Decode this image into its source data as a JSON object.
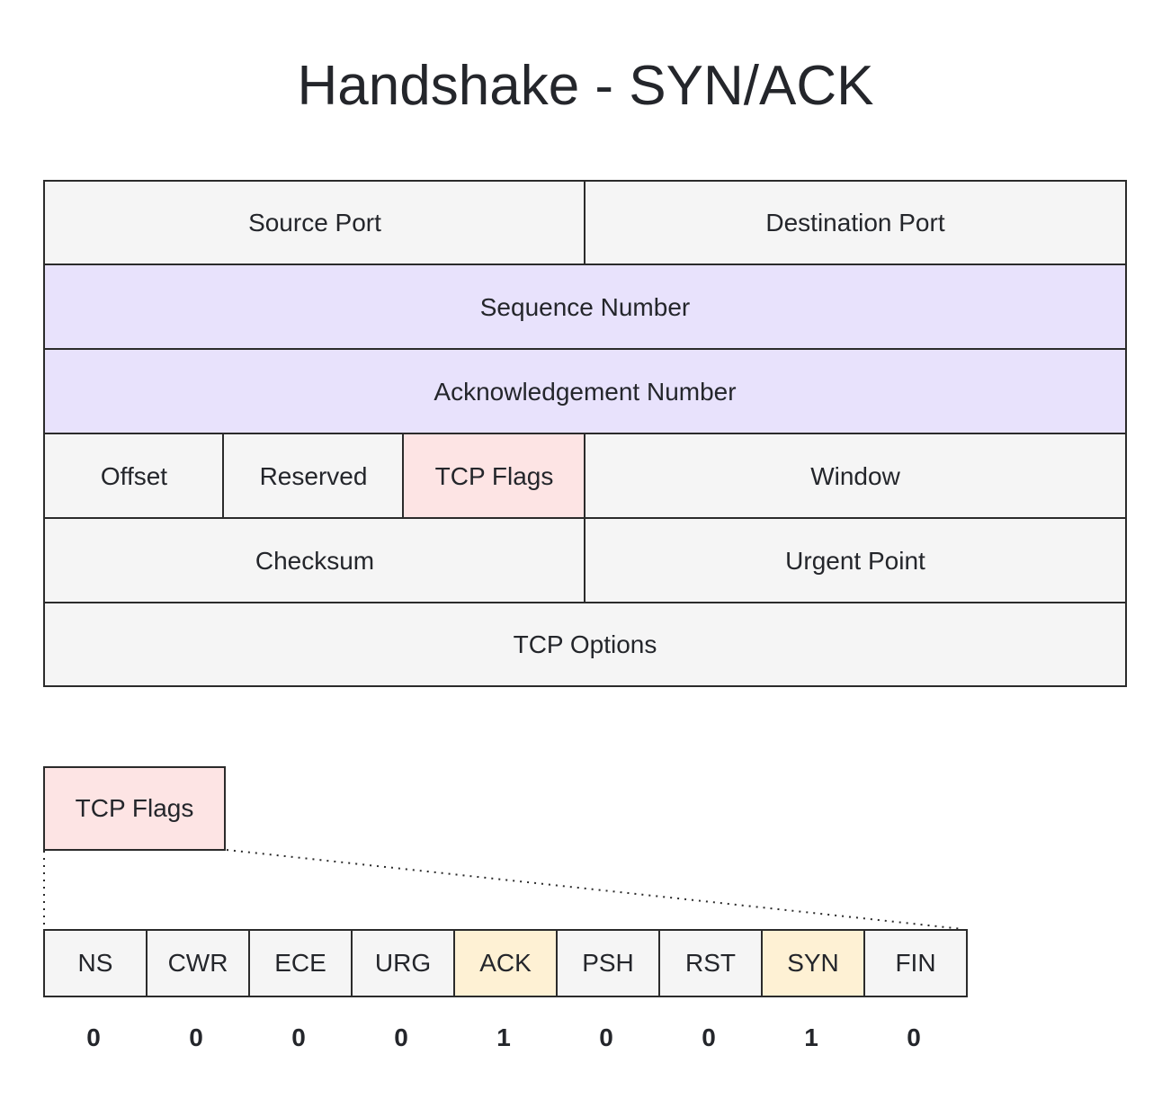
{
  "title": "Handshake - SYN/ACK",
  "header": {
    "source_port": "Source Port",
    "destination_port": "Destination Port",
    "sequence_number": "Sequence Number",
    "acknowledgement_number": "Acknowledgement Number",
    "offset": "Offset",
    "reserved": "Reserved",
    "tcp_flags": "TCP Flags",
    "window": "Window",
    "checksum": "Checksum",
    "urgent_point": "Urgent Point",
    "tcp_options": "TCP Options"
  },
  "flags_detail": {
    "label": "TCP Flags",
    "flags": [
      {
        "name": "NS",
        "value": "0",
        "highlight": false
      },
      {
        "name": "CWR",
        "value": "0",
        "highlight": false
      },
      {
        "name": "ECE",
        "value": "0",
        "highlight": false
      },
      {
        "name": "URG",
        "value": "0",
        "highlight": false
      },
      {
        "name": "ACK",
        "value": "1",
        "highlight": true
      },
      {
        "name": "PSH",
        "value": "0",
        "highlight": false
      },
      {
        "name": "RST",
        "value": "0",
        "highlight": false
      },
      {
        "name": "SYN",
        "value": "1",
        "highlight": true
      },
      {
        "name": "FIN",
        "value": "0",
        "highlight": false
      }
    ]
  },
  "colors": {
    "default_fill": "#f5f5f5",
    "number_fill": "#e8e2fc",
    "flags_fill": "#fde4e4",
    "set_flag_fill": "#fef1d4",
    "border": "#2b2b2b"
  }
}
